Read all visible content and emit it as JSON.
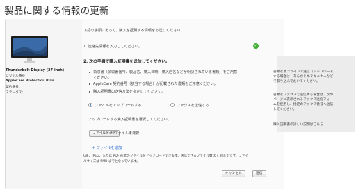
{
  "page": {
    "title": "製品に関する情報の更新"
  },
  "product": {
    "name": "Thunderbolt Display (27-inch)",
    "serial_label": "シリアル番号：",
    "plan_label": "AppleCare Protection Plan",
    "contract_label": "契約番号：",
    "status_label": "ステータス："
  },
  "main": {
    "intro": "下記の手順にそって、購入を証明する情報をお送りください。",
    "step1": "1. 連絡先情報を入力してください。",
    "step2": "2. 次の手順で購入証明書を送信してください。",
    "bullets": [
      "領収書（領収書番号、製品名、購入日時、購入店名などが明記されている書類）をご用意",
      "ください。",
      "AppleCare 契約番号（該当する場合）が記載された書類もご用意ください。",
      "購入証明書の送信方法を指定してください。"
    ],
    "radio_upload": "ファイルをアップロードする",
    "radio_fax": "ファクスを送信する",
    "upload_instruction": "アップロードする購入証明書を選択してください。",
    "choose_file_button": "ファイルを選択",
    "no_file_selected": "ファイル未選択",
    "add_file_link": "＋ ファイルを追加",
    "file_note_line1": "GIF、JPEG、または PDF 形式のファイルをアップロードできます。送信できるファイル数は 4 個までです。ファイ",
    "file_note_line2": "ルサイズは 5MB までとなっています。",
    "cancel_button": "キャンセル",
    "send_button": "送信"
  },
  "sidebar": {
    "upload_help": [
      "書類をオンラインで送信（アップロード）",
      "する場合は、あらかじめスキャナーなど",
      "で取り込んでおいてください。"
    ],
    "fax_help": [
      "書類をファクスで送信する場合は、次の",
      "ページに表示されるファクス送信フォー",
      "ムを使用し、指定のファクス番号へ送信",
      "してください。"
    ],
    "details_link": "購入証明書の詳しい説明はこちら"
  },
  "colors": {
    "accent": "#2a6fd0",
    "check": "#3fae34"
  }
}
